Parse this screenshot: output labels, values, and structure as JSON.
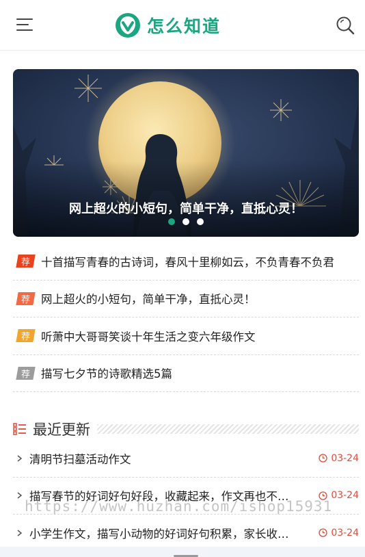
{
  "header": {
    "logo_text": "怎么知道",
    "menu_icon": "hamburger-menu-icon",
    "search_icon": "search-icon",
    "brand_color": "#1aa680"
  },
  "banner": {
    "caption": "网上超火的小短句，简单干净，直抵心灵！",
    "active_dot": 1,
    "dot_count": 3,
    "active_dot_color": "#1aa680"
  },
  "recommended": [
    {
      "tag": "荐",
      "tag_color": "#e8431e",
      "title": "十首描写青春的古诗词，春风十里柳如云，不负青春不负君"
    },
    {
      "tag": "荐",
      "tag_color": "#ef6a45",
      "title": "网上超火的小短句，简单干净，直抵心灵！"
    },
    {
      "tag": "荐",
      "tag_color": "#f2a52c",
      "title": "听萧中大哥哥笑谈十年生活之变六年级作文"
    },
    {
      "tag": "荐",
      "tag_color": "#9c9c9c",
      "title": "描写七夕节的诗歌精选5篇"
    }
  ],
  "recent": {
    "heading": "最近更新",
    "accent_color": "#e14a3a",
    "items": [
      {
        "title": "清明节扫墓活动作文",
        "date": "03-24"
      },
      {
        "title": "描写春节的好词好句好段，收藏起来，作文再也不愁了",
        "date": "03-24"
      },
      {
        "title": "小学生作文，描写小动物的好词好句积累，家长收藏起来",
        "date": "03-24"
      }
    ]
  },
  "watermark": "https://www.huzhan.com/ishop15931"
}
